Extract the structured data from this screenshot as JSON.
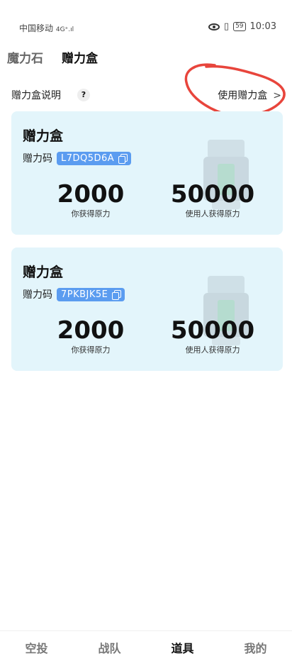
{
  "status_bar": {
    "carrier": "中国移动",
    "signal": "4G⁺.ıl",
    "battery": "59",
    "time": "10:03"
  },
  "top_tabs": [
    {
      "label": "魔力石",
      "active": false
    },
    {
      "label": "赠力盒",
      "active": true
    }
  ],
  "help": {
    "label": "赠力盒说明",
    "question": "?",
    "use_link": "使用赠力盒",
    "chevron": ">"
  },
  "cards": [
    {
      "title": "赠力盒",
      "code_label": "赠力码",
      "code": "L7DQ5D6A",
      "you_value": "2000",
      "you_label": "你获得原力",
      "user_value": "50000",
      "user_label": "使用人获得原力"
    },
    {
      "title": "赠力盒",
      "code_label": "赠力码",
      "code": "7PKBJK5E",
      "you_value": "2000",
      "you_label": "你获得原力",
      "user_value": "50000",
      "user_label": "使用人获得原力"
    }
  ],
  "bottom_nav": [
    {
      "label": "空投",
      "active": false
    },
    {
      "label": "战队",
      "active": false
    },
    {
      "label": "道具",
      "active": true
    },
    {
      "label": "我的",
      "active": false
    }
  ],
  "colors": {
    "accent": "#5b9cf0",
    "card_bg": "#e3f5fb",
    "annotation": "#e8453c"
  }
}
